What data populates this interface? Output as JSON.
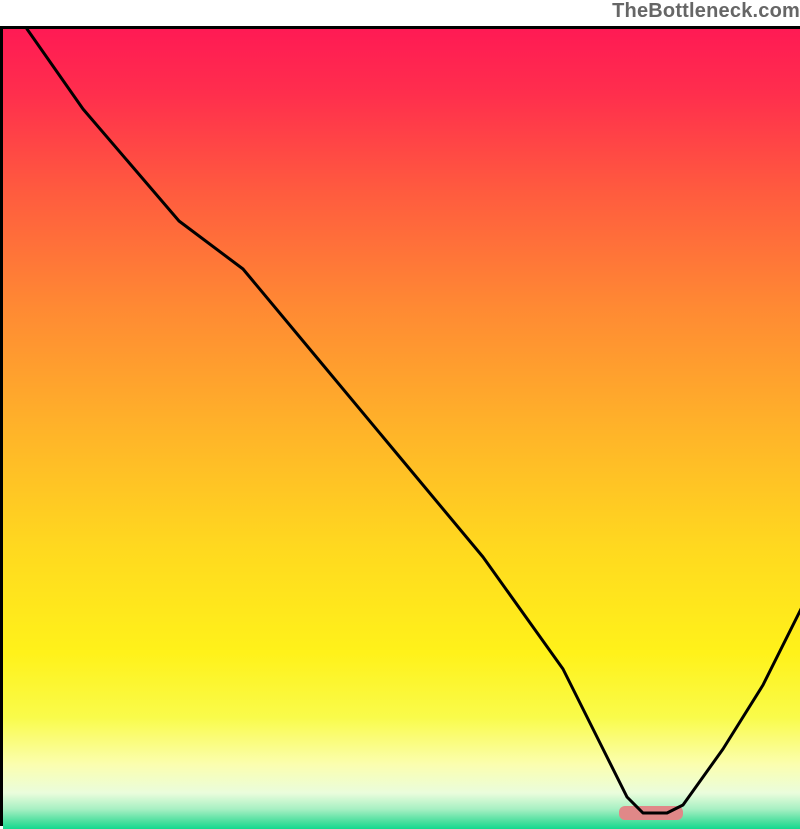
{
  "watermark": "TheBottleneck.com",
  "chart_data": {
    "type": "line",
    "title": "",
    "xlabel": "",
    "ylabel": "",
    "xlim": [
      0,
      100
    ],
    "ylim": [
      0,
      100
    ],
    "grid": false,
    "series": [
      {
        "name": "bottleneck-curve",
        "x": [
          3,
          10,
          22,
          30,
          40,
          50,
          60,
          70,
          75,
          78,
          80,
          83,
          85,
          90,
          95,
          100
        ],
        "y": [
          100,
          90,
          76,
          70,
          58,
          46,
          34,
          20,
          10,
          4,
          2,
          2,
          3,
          10,
          18,
          28
        ],
        "color": "#000000",
        "line_width": 3
      }
    ],
    "marker": {
      "name": "optimal-marker",
      "x_center": 81,
      "y": 2,
      "width": 8,
      "color": "#e08888"
    },
    "gradient_stops": [
      {
        "offset": 0.0,
        "color": "#ff1a54"
      },
      {
        "offset": 0.08,
        "color": "#ff2e4d"
      },
      {
        "offset": 0.2,
        "color": "#ff5a3f"
      },
      {
        "offset": 0.35,
        "color": "#ff8a33"
      },
      {
        "offset": 0.5,
        "color": "#ffb329"
      },
      {
        "offset": 0.65,
        "color": "#ffd91f"
      },
      {
        "offset": 0.78,
        "color": "#fff21a"
      },
      {
        "offset": 0.86,
        "color": "#f9fb4a"
      },
      {
        "offset": 0.92,
        "color": "#fbfeb0"
      },
      {
        "offset": 0.955,
        "color": "#eafddc"
      },
      {
        "offset": 0.975,
        "color": "#a8f0c3"
      },
      {
        "offset": 0.99,
        "color": "#4fe0a0"
      },
      {
        "offset": 1.0,
        "color": "#14d98e"
      }
    ]
  }
}
